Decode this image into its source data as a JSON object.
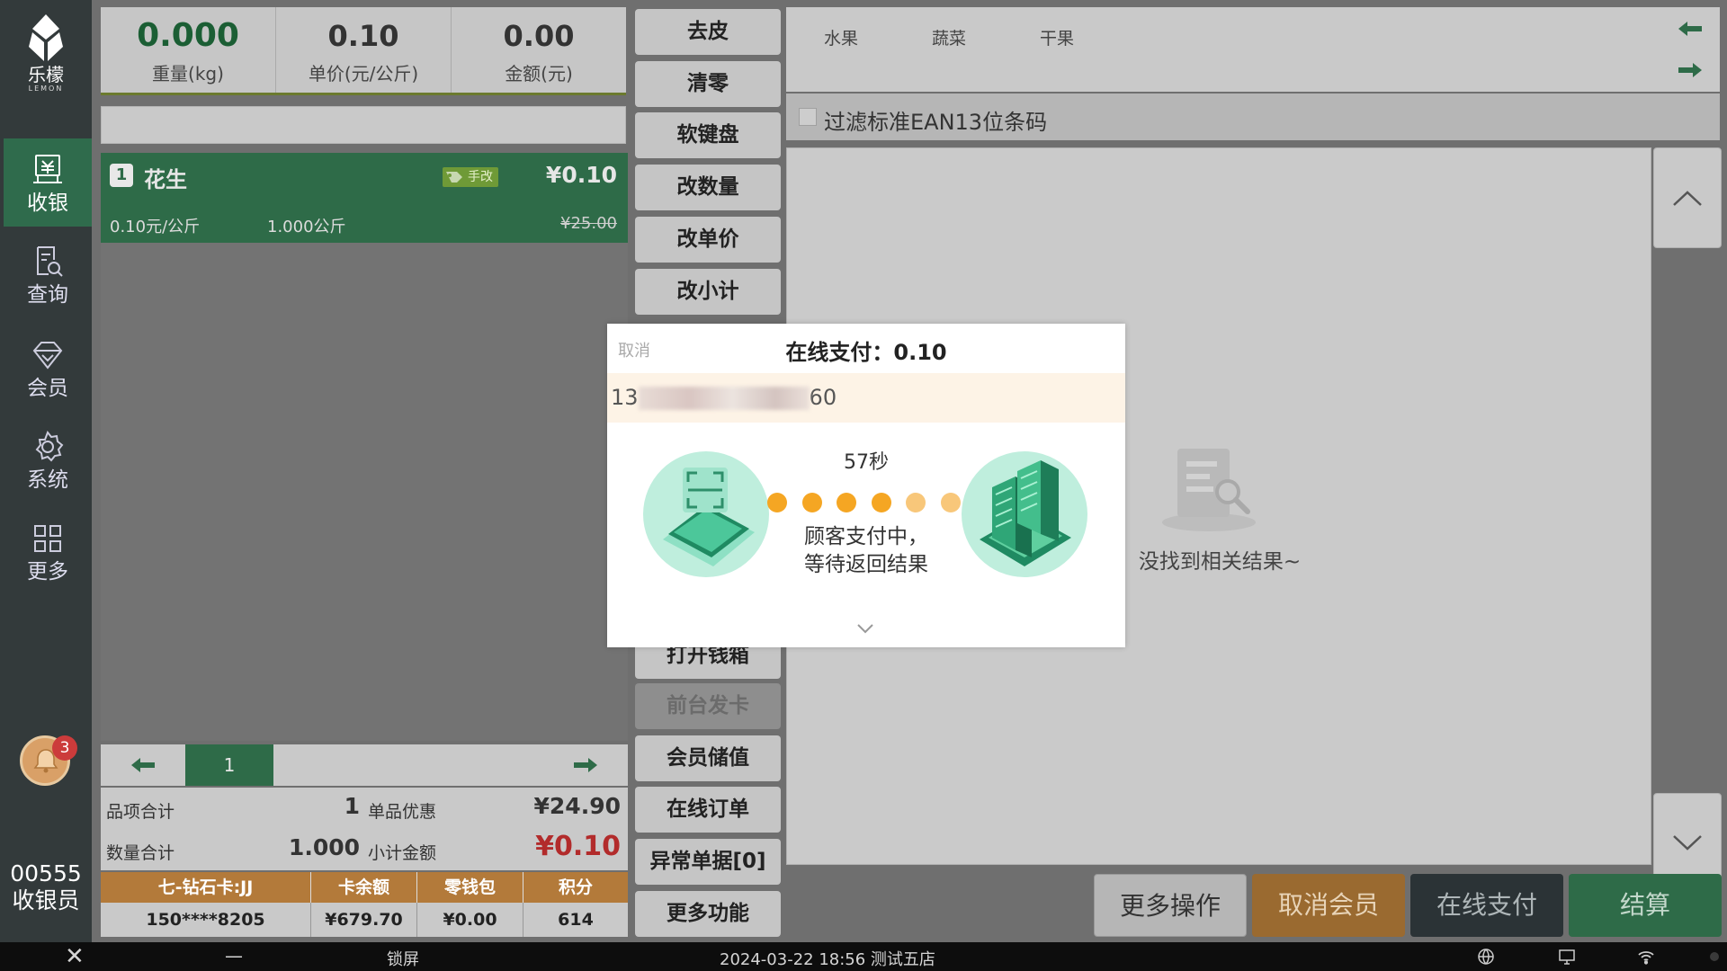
{
  "sidebar": {
    "logo": {
      "name": "乐檬",
      "sub": "LEMON"
    },
    "items": [
      {
        "label": "收银",
        "icon": "register-icon",
        "active": true
      },
      {
        "label": "查询",
        "icon": "search-doc-icon"
      },
      {
        "label": "会员",
        "icon": "diamond-icon"
      },
      {
        "label": "系统",
        "icon": "gear-icon"
      },
      {
        "label": "更多",
        "icon": "grid-icon"
      }
    ],
    "notification_count": "3",
    "cashier_id": "00555",
    "cashier_role": "收银员"
  },
  "readouts": {
    "weight": {
      "value": "0.000",
      "label": "重量(kg)"
    },
    "unit_price": {
      "value": "0.10",
      "label": "单价(元/公斤)"
    },
    "amount": {
      "value": "0.00",
      "label": "金额(元)"
    }
  },
  "order": {
    "item": {
      "index": "1",
      "name": "花生",
      "tag": "手改",
      "price": "¥0.10",
      "unit_price": "0.10元/公斤",
      "quantity": "1.000公斤",
      "original_price": "¥25.00"
    },
    "page": "1"
  },
  "totals": {
    "item_total_label": "品项合计",
    "item_total": "1",
    "discount_label": "单品优惠",
    "discount": "¥24.90",
    "qty_total_label": "数量合计",
    "qty_total": "1.000",
    "subtotal_label": "小计金额",
    "subtotal": "¥0.10"
  },
  "member": {
    "headers": [
      "七-钻石卡:JJ",
      "卡余额",
      "零钱包",
      "积分"
    ],
    "values": [
      "150****8205",
      "¥679.70",
      "¥0.00",
      "614"
    ]
  },
  "function_buttons": [
    "去皮",
    "清零",
    "软键盘",
    "改数量",
    "改单价",
    "改小计",
    "打开钱箱",
    "前台发卡",
    "会员储值",
    "在线订单",
    "异常单据[0]",
    "更多功能"
  ],
  "categories": [
    "水果",
    "蔬菜",
    "干果"
  ],
  "filter_label": "过滤标准EAN13位条码",
  "empty_text": "没找到相关结果~",
  "actions": {
    "more": "更多操作",
    "cancel_member": "取消会员",
    "online_pay": "在线支付",
    "settle": "结算"
  },
  "statusbar": {
    "lock": "锁屏",
    "datetime": "2024-03-22 18:56 测试五店"
  },
  "modal": {
    "cancel": "取消",
    "title": "在线支付：0.10",
    "code_prefix": "13",
    "code_suffix": "60",
    "timer": "57秒",
    "message": "顾客支付中，\n等待返回结果"
  },
  "colors": {
    "brand_green": "#2e6b48",
    "member_orange": "#b37a3a",
    "amount_red": "#b22b2b",
    "dot_orange": "#f5a623"
  }
}
